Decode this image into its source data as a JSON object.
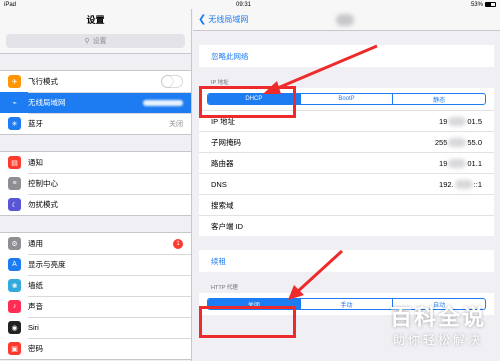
{
  "status_bar": {
    "device": "iPad",
    "wifi_icon": "wifi-icon",
    "time": "09:31",
    "battery": "53%"
  },
  "sidebar": {
    "title": "设置",
    "search_placeholder": "设置",
    "groups": [
      [
        {
          "label": "飞行模式",
          "icon": "airplane-icon",
          "color": "#ff9500",
          "toggle": true
        },
        {
          "label": "无线局域网",
          "icon": "wifi-icon",
          "color": "#1e7cf2",
          "selected": true
        },
        {
          "label": "蓝牙",
          "icon": "bluetooth-icon",
          "color": "#1e7cf2",
          "value": "关闭"
        }
      ],
      [
        {
          "label": "通知",
          "icon": "notification-icon",
          "color": "#ff3b30"
        },
        {
          "label": "控制中心",
          "icon": "control-center-icon",
          "color": "#8e8e93"
        },
        {
          "label": "勿扰模式",
          "icon": "moon-icon",
          "color": "#5856d6"
        }
      ],
      [
        {
          "label": "通用",
          "icon": "gear-icon",
          "color": "#8e8e93",
          "badge": "1"
        },
        {
          "label": "显示与亮度",
          "icon": "display-icon",
          "color": "#1e7cf2"
        },
        {
          "label": "墙纸",
          "icon": "wallpaper-icon",
          "color": "#34aadc"
        },
        {
          "label": "声音",
          "icon": "sound-icon",
          "color": "#ff2d55"
        },
        {
          "label": "Siri",
          "icon": "siri-icon",
          "color": "#222222"
        },
        {
          "label": "密码",
          "icon": "passcode-icon",
          "color": "#ff3b30"
        }
      ]
    ]
  },
  "main": {
    "back_label": "无线局域网",
    "forget_label": "忽略此网络",
    "ip_section_label": "IP 地址",
    "ip_modes": [
      "DHCP",
      "BootP",
      "静态"
    ],
    "ip_mode_selected": "DHCP",
    "info_rows": [
      {
        "key": "IP 地址",
        "value_parts": [
          "19",
          "01.5"
        ]
      },
      {
        "key": "子网掩码",
        "value_parts": [
          "255",
          "55.0"
        ]
      },
      {
        "key": "路由器",
        "value_parts": [
          "19",
          "01.1"
        ]
      },
      {
        "key": "DNS",
        "value_parts": [
          "192.",
          "::1"
        ]
      },
      {
        "key": "搜索域",
        "value_parts": []
      },
      {
        "key": "客户端 ID",
        "value_parts": []
      }
    ],
    "renew_label": "续租",
    "proxy_section_label": "HTTP 代理",
    "proxy_modes": [
      "关闭",
      "手动",
      "自动"
    ],
    "proxy_mode_selected": "关闭"
  },
  "watermark": {
    "title": "百科全说",
    "subtitle": "助你轻松解决"
  },
  "colors": {
    "accent": "#1e7cf2",
    "highlight_box": "#ee2b2b",
    "badge": "#ff3b30"
  }
}
